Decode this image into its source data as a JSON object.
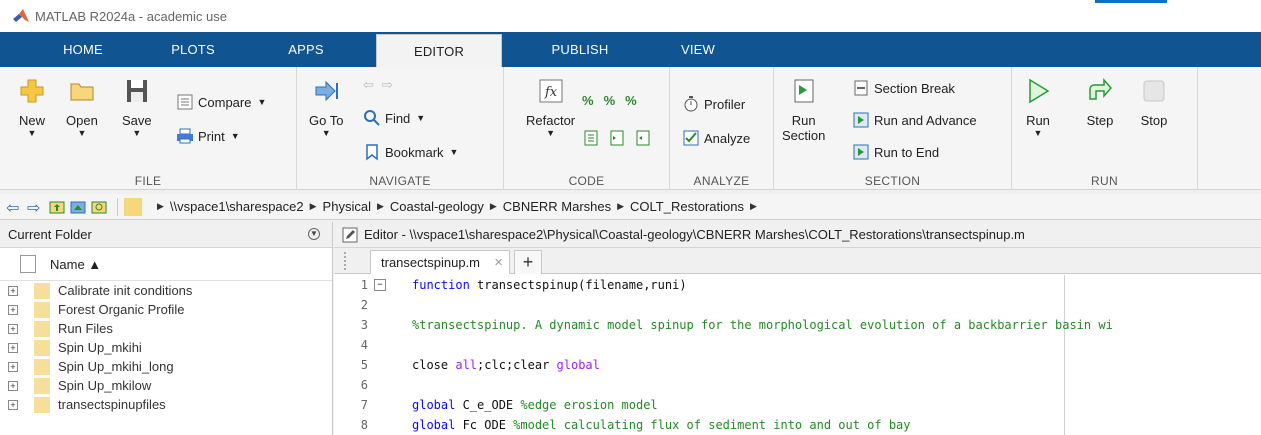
{
  "window": {
    "title": "MATLAB R2024a - academic use"
  },
  "ribbon": {
    "tabs": [
      {
        "label": "HOME"
      },
      {
        "label": "PLOTS"
      },
      {
        "label": "APPS"
      },
      {
        "label": "EDITOR",
        "active": true
      },
      {
        "label": "PUBLISH"
      },
      {
        "label": "VIEW"
      }
    ],
    "groups": {
      "file": {
        "label": "FILE",
        "new": "New",
        "open": "Open",
        "save": "Save",
        "compare": "Compare",
        "print": "Print"
      },
      "navigate": {
        "label": "NAVIGATE",
        "goto": "Go To",
        "find": "Find",
        "bookmark": "Bookmark"
      },
      "code": {
        "label": "CODE",
        "refactor": "Refactor"
      },
      "analyze": {
        "label": "ANALYZE",
        "profiler": "Profiler",
        "analyze": "Analyze"
      },
      "section": {
        "label": "SECTION",
        "run_section_1": "Run",
        "run_section_2": "Section",
        "section_break": "Section Break",
        "run_and_advance": "Run and Advance",
        "run_to_end": "Run to End"
      },
      "run": {
        "label": "RUN",
        "run": "Run",
        "step": "Step",
        "stop": "Stop"
      }
    }
  },
  "address": {
    "crumbs": [
      "\\\\vspace1\\sharespace2",
      "Physical",
      "Coastal-geology",
      "CBNERR Marshes",
      "COLT_Restorations"
    ]
  },
  "current_folder": {
    "title": "Current Folder",
    "column_name": "Name ▲",
    "items": [
      "Calibrate init conditions",
      "Forest Organic Profile",
      "Run Files",
      "Spin Up_mkihi",
      "Spin Up_mkihi_long",
      "Spin Up_mkilow",
      "transectspinupfiles"
    ]
  },
  "editor": {
    "title": "Editor - \\\\vspace1\\sharespace2\\Physical\\Coastal-geology\\CBNERR Marshes\\COLT_Restorations\\transectspinup.m",
    "tab": "transectspinup.m",
    "lines": [
      {
        "n": "1",
        "fold": "−",
        "parts": [
          [
            "kw",
            "function "
          ],
          [
            "t",
            "transectspinup(filename,runi)"
          ]
        ]
      },
      {
        "n": "2",
        "fold": "",
        "parts": []
      },
      {
        "n": "3",
        "fold": "",
        "parts": [
          [
            "cm",
            "%transectspinup. A dynamic model spinup for the morphological evolution of a backbarrier basin wi"
          ]
        ]
      },
      {
        "n": "4",
        "fold": "",
        "parts": []
      },
      {
        "n": "5",
        "fold": "",
        "parts": [
          [
            "t",
            "close "
          ],
          [
            "pu",
            "all"
          ],
          [
            "t",
            ";clc;clear "
          ],
          [
            "pu",
            "global"
          ]
        ]
      },
      {
        "n": "6",
        "fold": "",
        "parts": []
      },
      {
        "n": "7",
        "fold": "",
        "parts": [
          [
            "kw",
            "global "
          ],
          [
            "t",
            "C_e_ODE "
          ],
          [
            "cm",
            "%edge erosion model"
          ]
        ]
      },
      {
        "n": "8",
        "fold": "",
        "parts": [
          [
            "kw",
            "global "
          ],
          [
            "t",
            "Fc ODE "
          ],
          [
            "cm",
            "%model calculating flux of sediment into and out of bay"
          ]
        ]
      }
    ]
  }
}
